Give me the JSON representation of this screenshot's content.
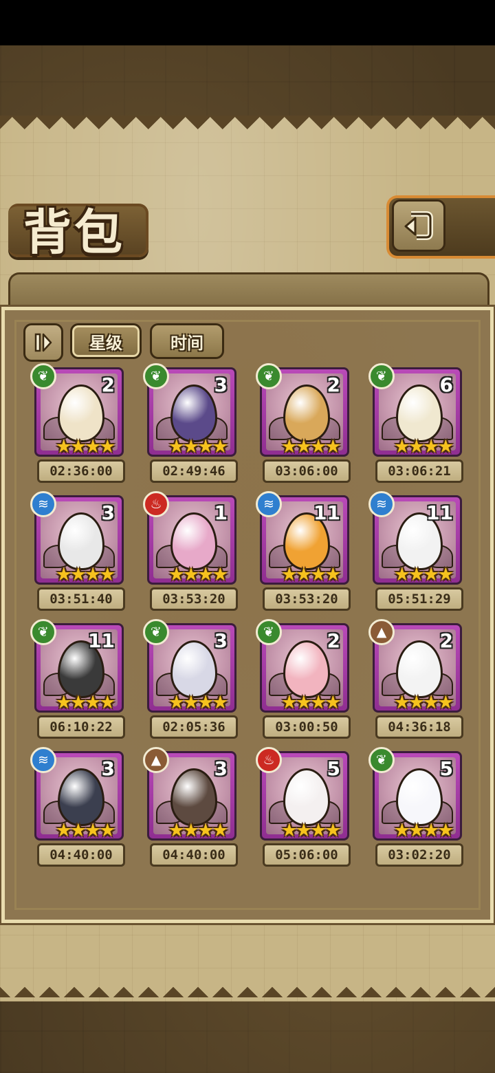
{
  "title": "背包",
  "sort_tabs": [
    "星级",
    "时间"
  ],
  "items": [
    {
      "element": "nature",
      "count": "2",
      "stars": 4,
      "timer": "02:36:00",
      "egg": "#efe3c8"
    },
    {
      "element": "nature",
      "count": "3",
      "stars": 4,
      "timer": "02:49:46",
      "egg": "#5b4a8a"
    },
    {
      "element": "nature",
      "count": "2",
      "stars": 4,
      "timer": "03:06:00",
      "egg": "#d9a85a"
    },
    {
      "element": "nature",
      "count": "6",
      "stars": 4,
      "timer": "03:06:21",
      "egg": "#f0e8d0"
    },
    {
      "element": "water",
      "count": "3",
      "stars": 4,
      "timer": "03:51:40",
      "egg": "#e8e8e8"
    },
    {
      "element": "fire",
      "count": "1",
      "stars": 4,
      "timer": "03:53:20",
      "egg": "#e7a9c9"
    },
    {
      "element": "water",
      "count": "11",
      "stars": 4,
      "timer": "03:53:20",
      "egg": "#f0a233"
    },
    {
      "element": "water",
      "count": "11",
      "stars": 4,
      "timer": "05:51:29",
      "egg": "#f2f2f2"
    },
    {
      "element": "nature",
      "count": "11",
      "stars": 4,
      "timer": "06:10:22",
      "egg": "#3a3a3a"
    },
    {
      "element": "nature",
      "count": "3",
      "stars": 4,
      "timer": "02:05:36",
      "egg": "#d8d8e6"
    },
    {
      "element": "nature",
      "count": "2",
      "stars": 4,
      "timer": "03:00:50",
      "egg": "#f2b4bf"
    },
    {
      "element": "earth",
      "count": "2",
      "stars": 4,
      "timer": "04:36:18",
      "egg": "#f3f3f3"
    },
    {
      "element": "water",
      "count": "3",
      "stars": 4,
      "timer": "04:40:00",
      "egg": "#3b3f4f"
    },
    {
      "element": "earth",
      "count": "3",
      "stars": 4,
      "timer": "04:40:00",
      "egg": "#5d4a40"
    },
    {
      "element": "fire",
      "count": "5",
      "stars": 4,
      "timer": "05:06:00",
      "egg": "#f4f0f0"
    },
    {
      "element": "nature",
      "count": "5",
      "stars": 4,
      "timer": "03:02:20",
      "egg": "#f7f7fb"
    }
  ]
}
